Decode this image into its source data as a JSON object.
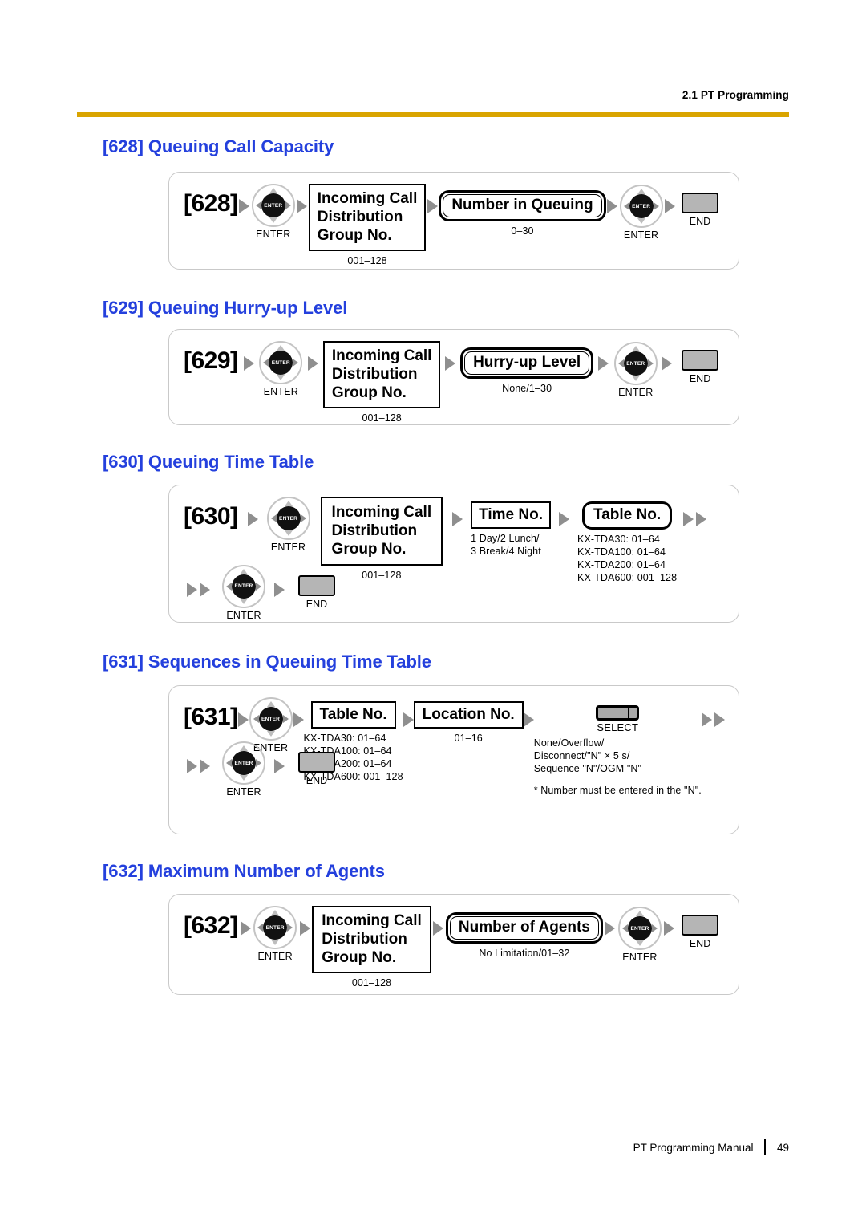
{
  "header": {
    "section_label": "2.1 PT Programming"
  },
  "footer": {
    "manual_title": "PT Programming Manual",
    "page_number": "49"
  },
  "colors": {
    "heading_blue": "#2440dd",
    "rule_gold": "#d9a400",
    "key_gray": "#b5b5b5"
  },
  "keys": {
    "enter_label": "ENTER",
    "enter_hub_text": "ENTER",
    "end_label": "END",
    "select_label": "SELECT"
  },
  "sections": [
    {
      "heading": "[628] Queuing Call Capacity",
      "code": "[628]",
      "field1_line1": "Incoming Call",
      "field1_line2": "Distribution",
      "field1_line3": "Group No.",
      "field1_caption": "001–128",
      "field2_label": "Number in Queuing",
      "field2_caption": "0–30"
    },
    {
      "heading": "[629] Queuing Hurry-up Level",
      "code": "[629]",
      "field1_line1": "Incoming Call",
      "field1_line2": "Distribution",
      "field1_line3": "Group No.",
      "field1_caption": "001–128",
      "field2_label": "Hurry-up Level",
      "field2_caption": "None/1–30"
    },
    {
      "heading": "[630] Queuing Time Table",
      "code": "[630]",
      "field1_line1": "Incoming Call",
      "field1_line2": "Distribution",
      "field1_line3": "Group No.",
      "field1_caption": "001–128",
      "field2_label": "Time No.",
      "field2_caption": "1 Day/2 Lunch/\n3 Break/4 Night",
      "field3_label": "Table No.",
      "field3_caption": "KX-TDA30: 01–64\nKX-TDA100: 01–64\nKX-TDA200: 01–64\nKX-TDA600: 001–128"
    },
    {
      "heading": "[631] Sequences in Queuing Time Table",
      "code": "[631]",
      "field1_label": "Table No.",
      "field1_caption": "KX-TDA30: 01–64\nKX-TDA100: 01–64\nKX-TDA200: 01–64\nKX-TDA600: 001–128",
      "field2_label": "Location No.",
      "field2_caption": "01–16",
      "select_caption": "None/Overflow/\nDisconnect/\"N\" × 5 s/\nSequence \"N\"/OGM \"N\"",
      "footnote": "* Number must be entered in the \"N\"."
    },
    {
      "heading": "[632] Maximum Number of Agents",
      "code": "[632]",
      "field1_line1": "Incoming Call",
      "field1_line2": "Distribution",
      "field1_line3": "Group No.",
      "field1_caption": "001–128",
      "field2_label": "Number of Agents",
      "field2_caption": "No Limitation/01–32"
    }
  ]
}
